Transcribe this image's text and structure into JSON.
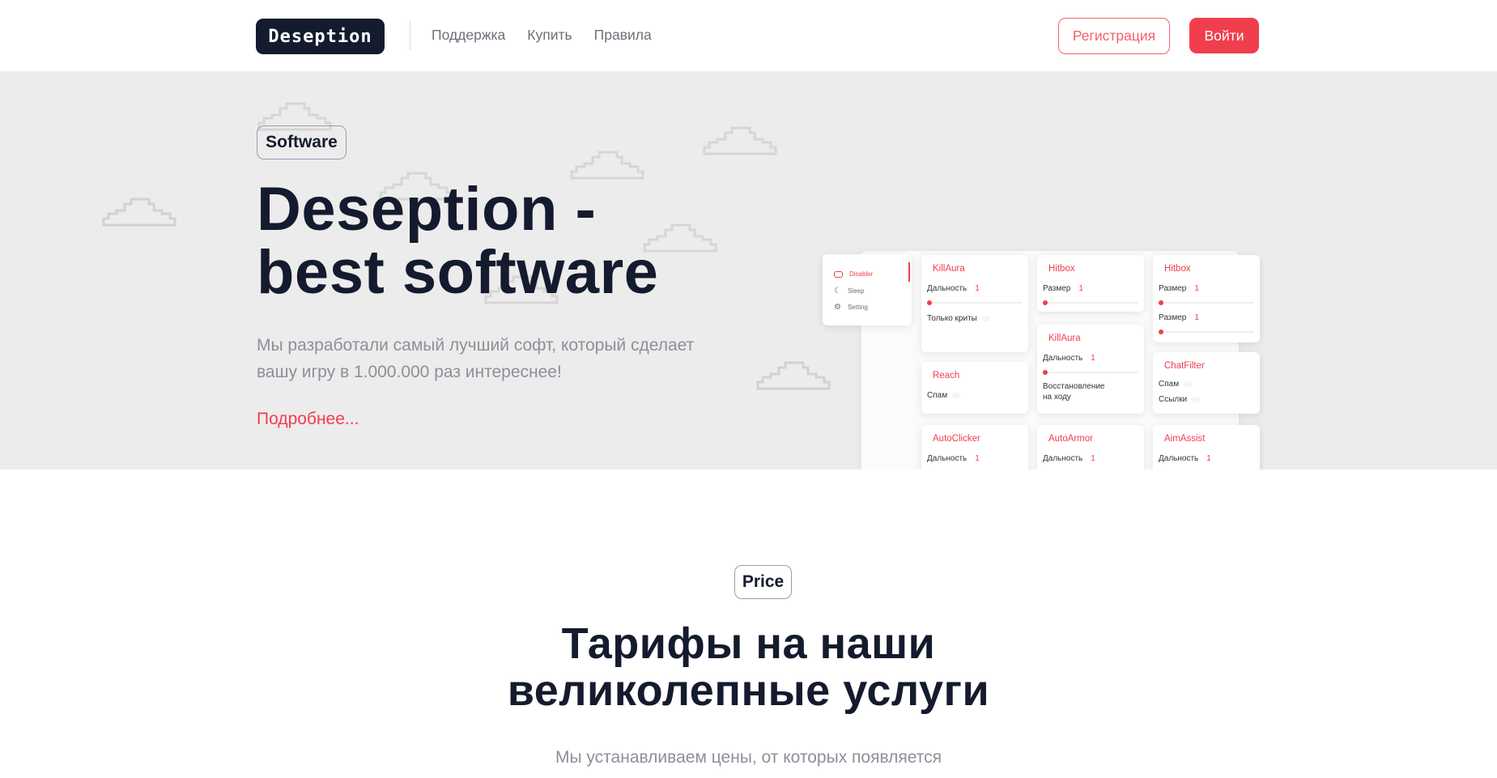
{
  "header": {
    "logo_text": "Deseption",
    "nav": [
      "Поддержка",
      "Купить",
      "Правила"
    ],
    "register_label": "Регистрация",
    "login_label": "Войти"
  },
  "hero": {
    "tag": "Software",
    "title_line1": "Deseption -",
    "title_line2": "best software",
    "description": "Мы разработали самый лучший софт, который сделает вашу игру в 1.000.000 раз интереснее!",
    "more_link": "Подробнее..."
  },
  "mockup": {
    "sidebar": [
      "Disabler",
      "Sleep",
      "Setting"
    ],
    "cards": {
      "killaura1": {
        "title": "KillAura",
        "row1": "Дальность",
        "val1": "1",
        "row2": "Только криты"
      },
      "reach": {
        "title": "Reach",
        "row1": "Спам"
      },
      "autoclicker": {
        "title": "AutoClicker",
        "row1": "Дальность",
        "val1": "1"
      },
      "hitbox1": {
        "title": "Hitbox",
        "row1": "Размер",
        "val1": "1"
      },
      "killaura2": {
        "title": "KillAura",
        "row1": "Дальность",
        "val1": "1",
        "row2": "Восстановление на ходу"
      },
      "autoarmor": {
        "title": "AutoArmor",
        "row1": "Дальность",
        "val1": "1"
      },
      "hitbox2": {
        "title": "Hitbox",
        "row1": "Размер",
        "val1": "1",
        "row2": "Размер",
        "val2": "1"
      },
      "chatfilter": {
        "title": "ChatFilter",
        "row1": "Спам",
        "row2": "Ссылки"
      },
      "aimassist": {
        "title": "AimAssist",
        "row1": "Дальность",
        "val1": "1"
      }
    }
  },
  "price": {
    "tag": "Price",
    "title_line1": "Тарифы на наши",
    "title_line2": "великолепные услуги",
    "description": "Мы устанавливаем цены, от которых появляется"
  },
  "colors": {
    "accent": "#f03e4d",
    "dark": "#151b2e",
    "hero_bg": "#ececec"
  }
}
